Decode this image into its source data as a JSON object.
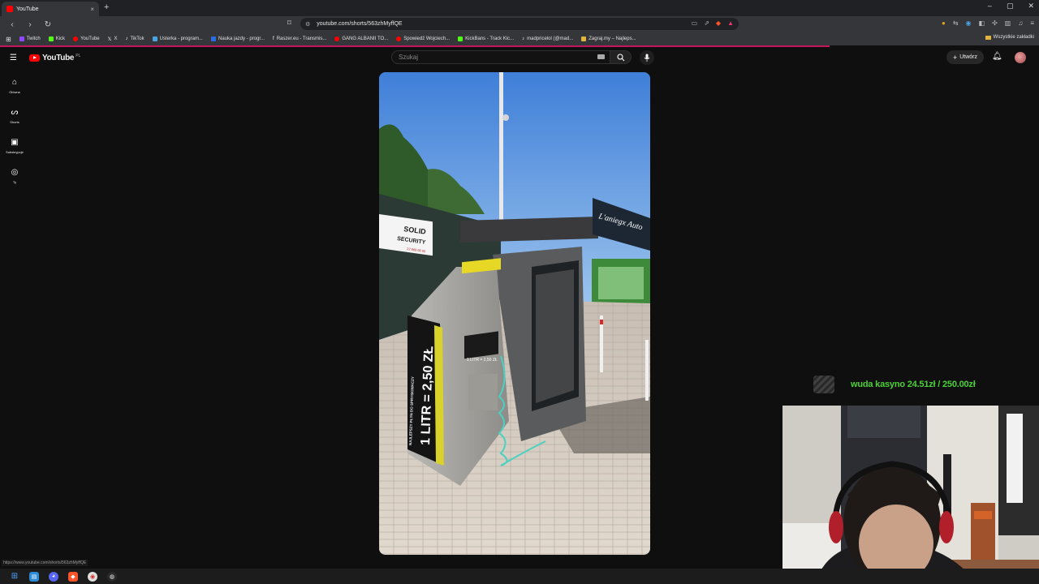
{
  "browser": {
    "tab_title": "YouTube",
    "tab_close": "×",
    "new_tab": "+",
    "window_controls": [
      "–",
      "▢",
      "✕"
    ],
    "url": "youtube.com/shorts/563zhMyffQE"
  },
  "bookmarks": [
    {
      "label": "Twitch",
      "color": "#9146ff"
    },
    {
      "label": "Kick",
      "color": "#53fc18"
    },
    {
      "label": "YouTube",
      "color": "#ff0000"
    },
    {
      "label": "X",
      "color": "#ffffff"
    },
    {
      "label": "TikTok",
      "color": "#ffffff"
    },
    {
      "label": "Usterka - program...",
      "color": "#4aa3df"
    },
    {
      "label": "Nauka jazdy - progr...",
      "color": "#2d6cdf"
    },
    {
      "label": "Raszer.eu - Transmis...",
      "color": "#ffffff"
    },
    {
      "label": "GANG ALBANII TO...",
      "color": "#ff0000"
    },
    {
      "label": "Spowiedź Wojciech...",
      "color": "#ff0000"
    },
    {
      "label": "KickBans - Track Kic...",
      "color": "#53fc18"
    },
    {
      "label": "madpricelol (@mad...",
      "color": "#ffffff"
    },
    {
      "label": "Zagraj.my – Najleps...",
      "color": "#e3b341"
    }
  ],
  "bookmarks_all": "Wszystkie zakładki",
  "youtube": {
    "logo_text": "YouTube",
    "country_code": "PL",
    "search_placeholder": "Szukaj",
    "create_label": "Utwórz",
    "rail": [
      {
        "label": "Główna",
        "icon": "home-icon"
      },
      {
        "label": "Shorts",
        "icon": "shorts-icon"
      },
      {
        "label": "Subskrypcje",
        "icon": "subscriptions-icon"
      },
      {
        "label": "Ty",
        "icon": "you-icon"
      }
    ]
  },
  "video": {
    "sign_brand_1": "SOLID",
    "sign_brand_2": "SECURITY",
    "sign_phone": "22 669 66 00",
    "store_sign": "L'aniegx Auto",
    "machine_text": "1 LITR = 2,50 ZŁ",
    "machine_side_text": "NAJLEPSZY PŁYN DO SPRYSKIWACZY",
    "label_small": "1 LITR = 2,50 ZŁ"
  },
  "status_url": "https://www.youtube.com/shorts/563zhMyffQE",
  "overlay": {
    "goal_text": "wuda kasyno 24.51zł / 250.00zł"
  },
  "colors": {
    "yt_red": "#ff0000",
    "goal_green": "#4cd137",
    "load_bar": "#c2185b"
  }
}
